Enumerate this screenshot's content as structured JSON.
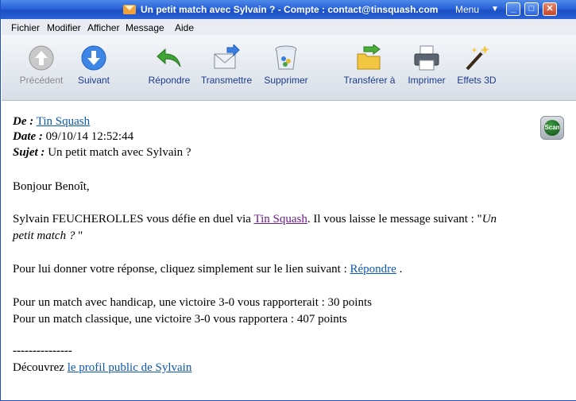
{
  "window": {
    "title": "Un petit match avec Sylvain ? - Compte : contact@tinsquash.com",
    "menu_label": "Menu"
  },
  "menubar": {
    "items": [
      "Fichier",
      "Modifier",
      "Afficher",
      "Message",
      "Aide"
    ]
  },
  "toolbar": {
    "buttons": [
      {
        "label": "Précédent",
        "icon": "previous-arrow-icon",
        "enabled": false
      },
      {
        "label": "Suivant",
        "icon": "next-arrow-icon",
        "enabled": true
      },
      {
        "label": "Répondre",
        "icon": "reply-arrow-icon",
        "enabled": true
      },
      {
        "label": "Transmettre",
        "icon": "forward-envelope-icon",
        "enabled": true
      },
      {
        "label": "Supprimer",
        "icon": "trash-bin-icon",
        "enabled": true
      },
      {
        "label": "Transférer à",
        "icon": "move-to-folder-icon",
        "enabled": true
      },
      {
        "label": "Imprimer",
        "icon": "printer-icon",
        "enabled": true
      },
      {
        "label": "Effets 3D",
        "icon": "magic-wand-icon",
        "enabled": true
      }
    ]
  },
  "message": {
    "from_label": "De :",
    "from_value": "Tin Squash",
    "date_label": "Date :",
    "date_value": "09/10/14 12:52:44",
    "subject_label": "Sujet :",
    "subject_value": "Un petit match avec Sylvain ?",
    "greeting": "Bonjour Benoît,",
    "p1_before": "Sylvain FEUCHEROLLES vous défie en duel via ",
    "p1_link": "Tin Squash",
    "p1_after": ". Il vous laisse le message suivant : \"",
    "p1_quote_line1": "Un",
    "p1_quote_line2": "petit match ? ",
    "p1_close": "\"",
    "p2_before": "Pour lui donner votre réponse, cliquez simplement sur le lien suivant : ",
    "p2_link": "Répondre",
    "p2_after": " .",
    "p3_line1": "Pour un match avec handicap, une victoire 3-0 vous rapporterait : 30 points",
    "p3_line2": "Pour un match classique, une victoire 3-0 vous rapportera : 407 points",
    "separator": "---------------",
    "p4_before": "Découvrez ",
    "p4_link": "le profil public de Sylvain",
    "scan_label": "Scan"
  },
  "colors": {
    "titlebar": "#2862d8",
    "link": "#0b57b5",
    "visited_link": "#6b1c8a"
  }
}
